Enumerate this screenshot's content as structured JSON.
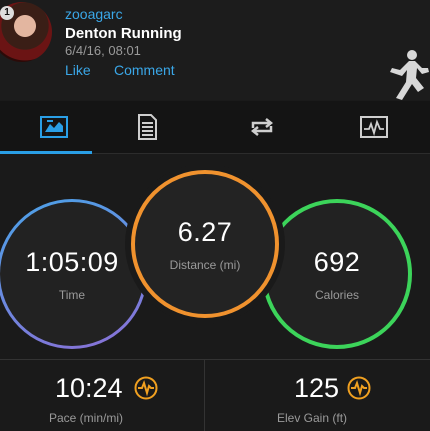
{
  "header": {
    "avatar_badge": "1",
    "username": "zooagarc",
    "activity_title": "Denton Running",
    "date": "6/4/16, 08:01",
    "like_label": "Like",
    "comment_label": "Comment",
    "activity_type_icon": "running-person-icon"
  },
  "tabs": [
    {
      "icon": "overview-icon",
      "active": true
    },
    {
      "icon": "details-list-icon",
      "active": false
    },
    {
      "icon": "laps-repeat-icon",
      "active": false
    },
    {
      "icon": "charts-icon",
      "active": false
    }
  ],
  "stats": {
    "time": {
      "value": "1:05:09",
      "label": "Time",
      "color": "#4aa3e8"
    },
    "distance": {
      "value": "6.27",
      "label": "Distance (mi)",
      "color": "#f0922e"
    },
    "calories": {
      "value": "692",
      "label": "Calories",
      "color": "#3cd45a"
    }
  },
  "metrics": {
    "pace": {
      "value": "10:24",
      "label": "Pace (min/mi)",
      "icon": "pulse-chart-icon"
    },
    "elev_gain": {
      "value": "125",
      "label": "Elev Gain (ft)",
      "icon": "pulse-chart-icon"
    }
  },
  "colors": {
    "accent": "#2a9fe6",
    "link": "#3aa7e8",
    "background": "#1a1a1a"
  }
}
